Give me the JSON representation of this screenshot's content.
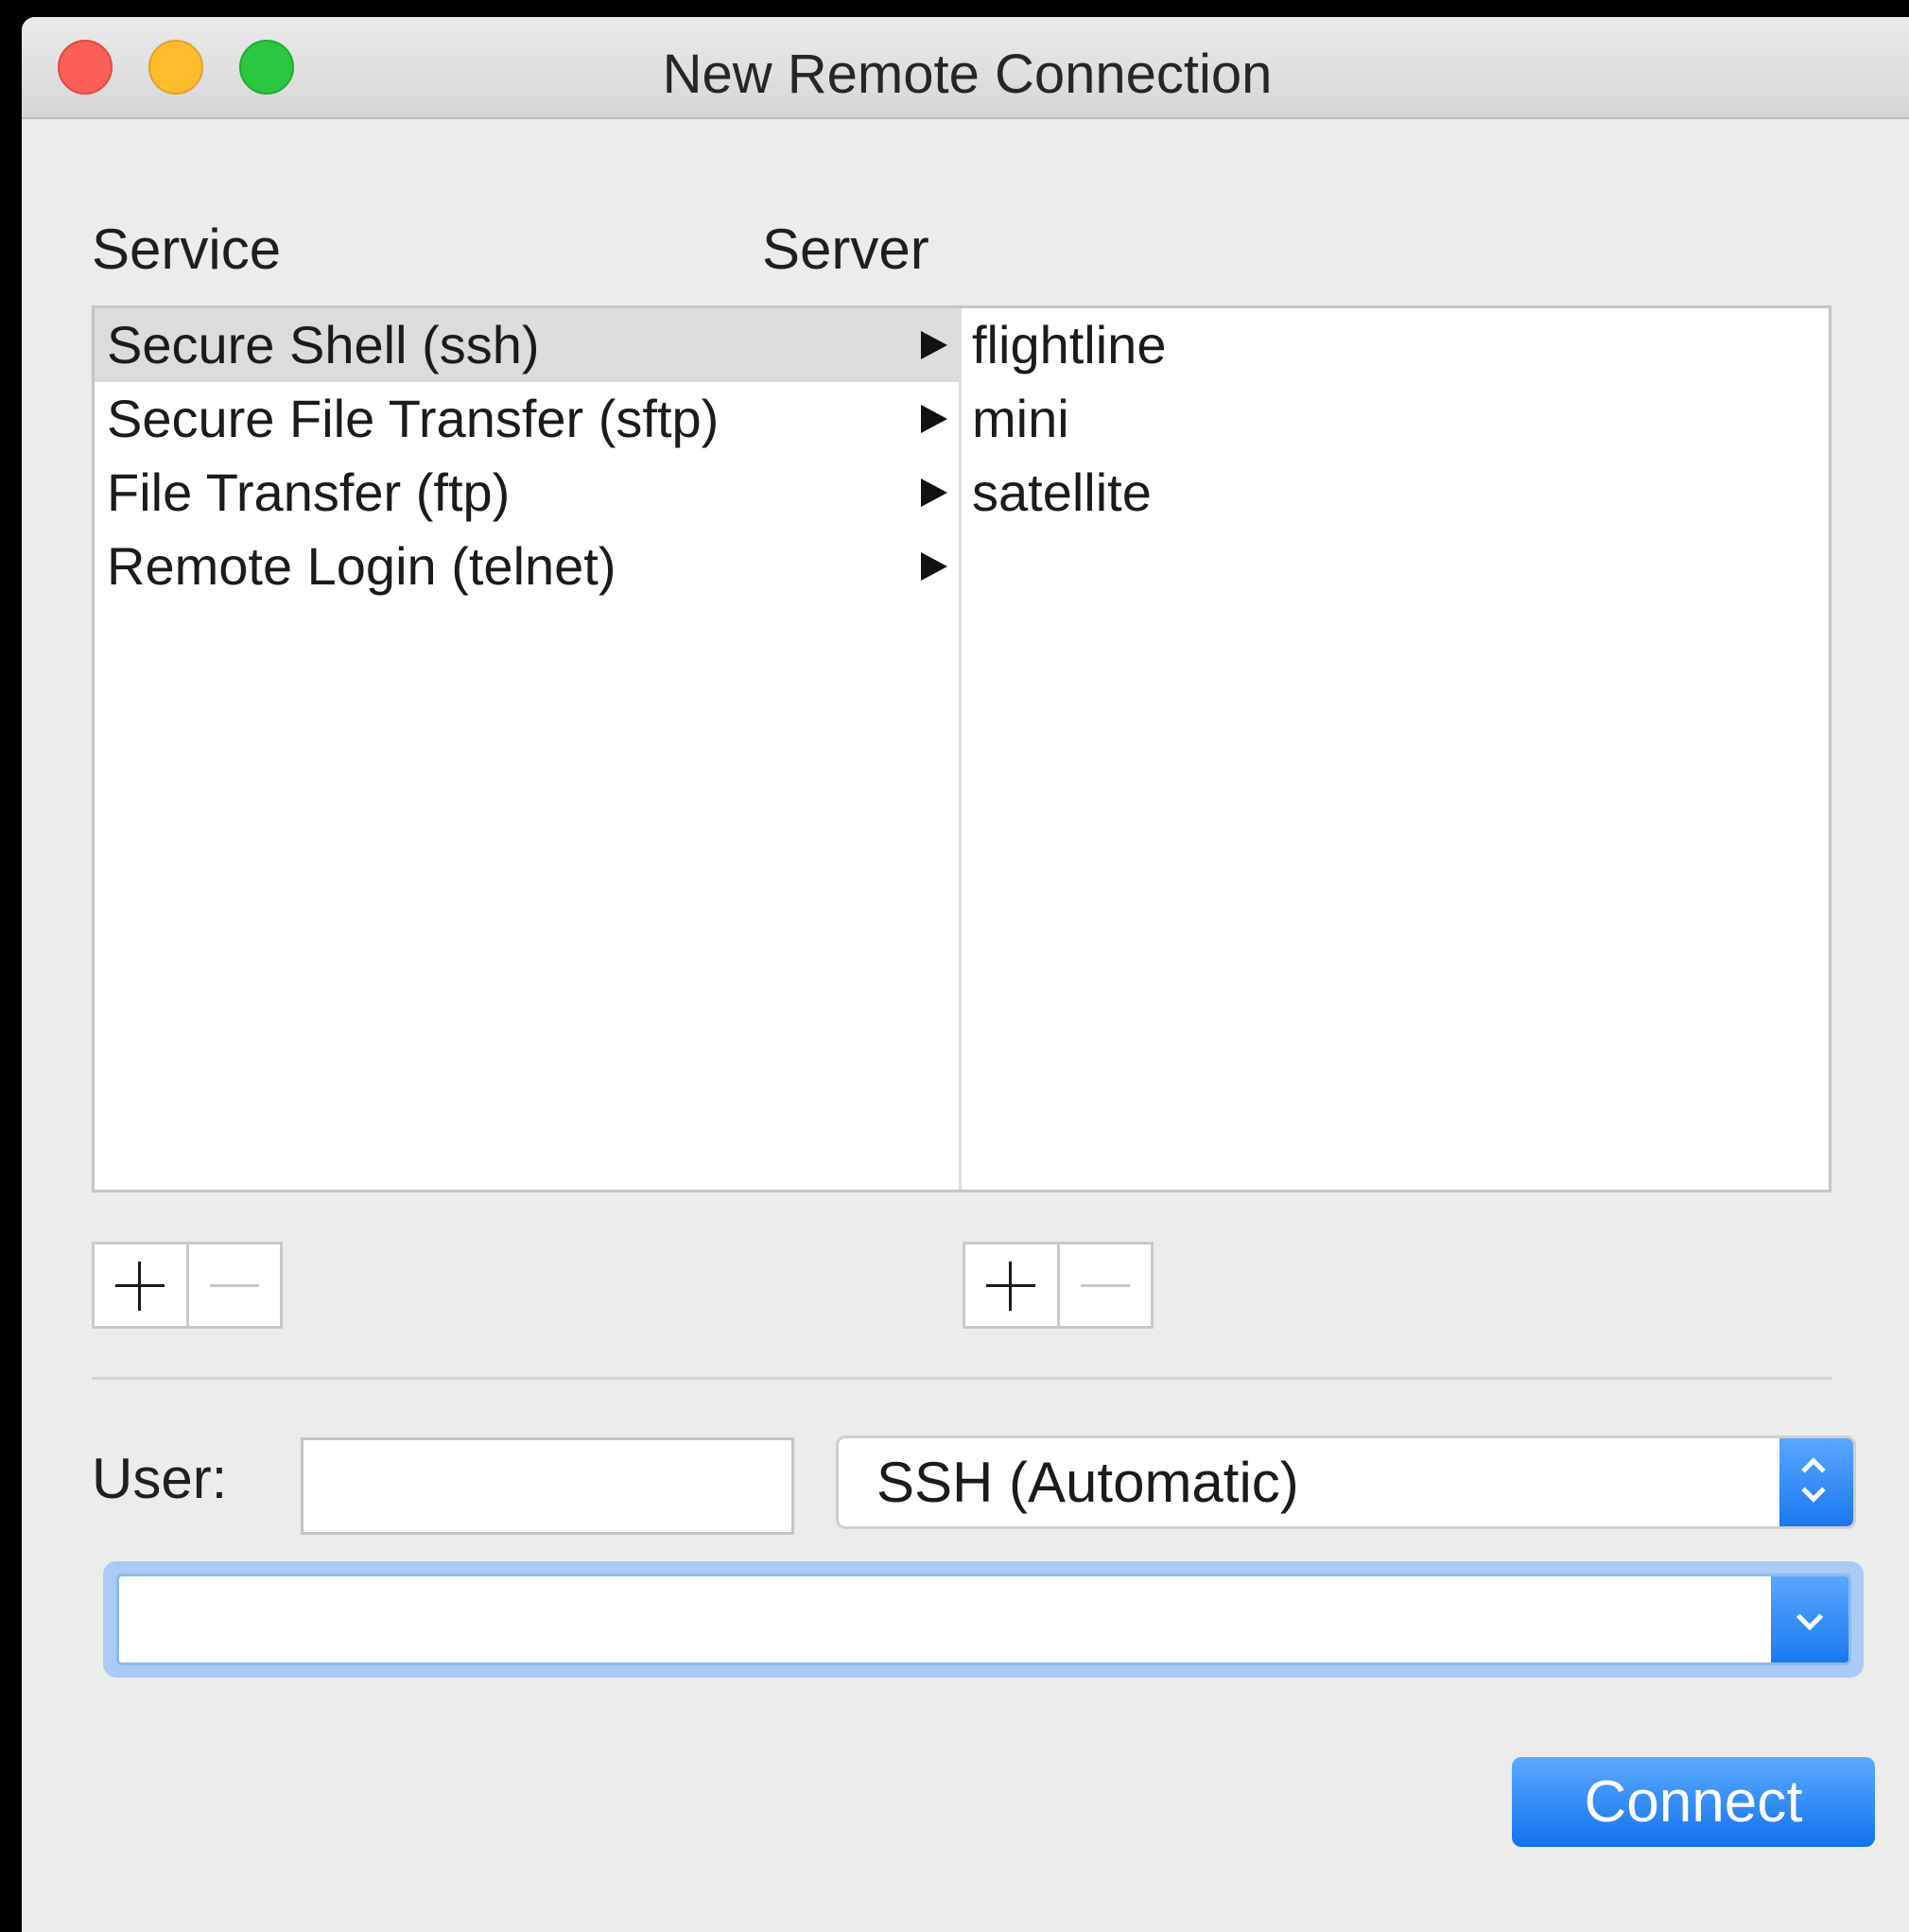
{
  "window": {
    "title": "New Remote Connection",
    "controls": [
      "close",
      "minimize",
      "zoom"
    ]
  },
  "service": {
    "heading": "Service",
    "items": [
      {
        "label": "Secure Shell (ssh)",
        "selected": true
      },
      {
        "label": "Secure File Transfer (sftp)",
        "selected": false
      },
      {
        "label": "File Transfer (ftp)",
        "selected": false
      },
      {
        "label": "Remote Login (telnet)",
        "selected": false
      }
    ]
  },
  "server": {
    "heading": "Server",
    "items": [
      {
        "label": "flightline"
      },
      {
        "label": "mini"
      },
      {
        "label": "satellite"
      }
    ]
  },
  "user": {
    "label": "User:",
    "value": ""
  },
  "protocol": {
    "selected": "SSH (Automatic)"
  },
  "command": {
    "value": ""
  },
  "actions": {
    "connect_label": "Connect"
  },
  "colors": {
    "accent": "#1a78f0",
    "selection": "#dcdcdc",
    "focus_ring": "#a9cbf5"
  }
}
